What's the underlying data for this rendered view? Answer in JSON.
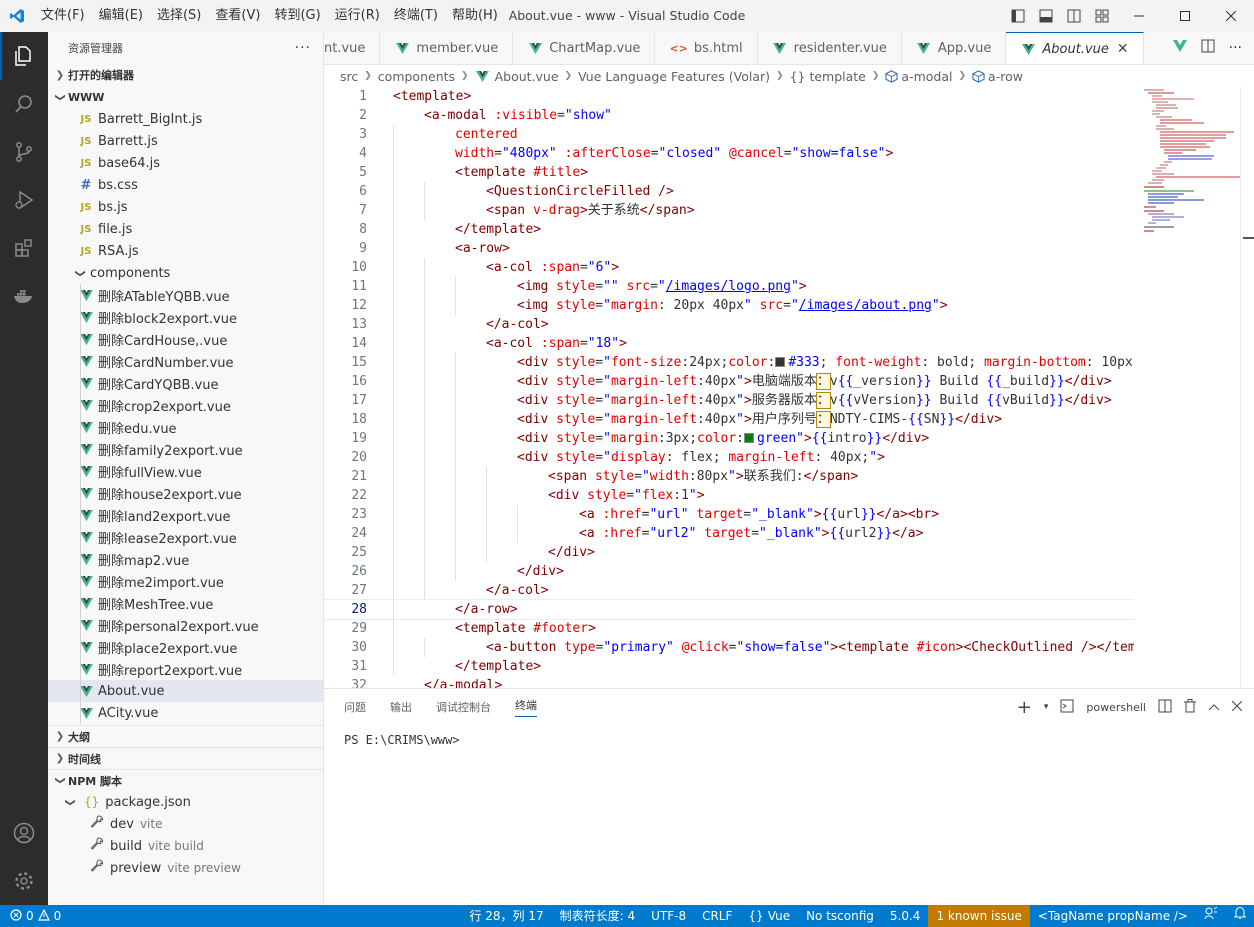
{
  "window": {
    "title": "About.vue - www - Visual Studio Code",
    "menu": [
      "文件(F)",
      "编辑(E)",
      "选择(S)",
      "查看(V)",
      "转到(G)",
      "运行(R)",
      "终端(T)",
      "帮助(H)"
    ]
  },
  "sidebar": {
    "title": "资源管理器",
    "open_editors": "打开的编辑器",
    "root": "WWW",
    "files": [
      {
        "name": "Barrett_BigInt.js",
        "type": "js"
      },
      {
        "name": "Barrett.js",
        "type": "js"
      },
      {
        "name": "base64.js",
        "type": "js"
      },
      {
        "name": "bs.css",
        "type": "css"
      },
      {
        "name": "bs.js",
        "type": "js"
      },
      {
        "name": "file.js",
        "type": "js"
      },
      {
        "name": "RSA.js",
        "type": "js"
      }
    ],
    "components_folder": "components",
    "components": [
      "删除ATableYQBB.vue",
      "删除block2export.vue",
      "删除CardHouse,.vue",
      "删除CardNumber.vue",
      "删除CardYQBB.vue",
      "删除crop2export.vue",
      "删除edu.vue",
      "删除family2export.vue",
      "删除fullView.vue",
      "删除house2export.vue",
      "删除land2export.vue",
      "删除lease2export.vue",
      "删除map2.vue",
      "删除me2import.vue",
      "删除MeshTree.vue",
      "删除personal2export.vue",
      "删除place2export.vue",
      "删除report2export.vue",
      "About.vue",
      "ACity.vue"
    ],
    "outline": "大纲",
    "timeline": "时间线",
    "npm": "NPM 脚本",
    "package": "package.json",
    "scripts": [
      {
        "name": "dev",
        "cmd": "vite"
      },
      {
        "name": "build",
        "cmd": "vite build"
      },
      {
        "name": "preview",
        "cmd": "vite preview"
      }
    ]
  },
  "tabs": [
    {
      "label": "nt.vue",
      "icon": "none"
    },
    {
      "label": "member.vue",
      "icon": "vue"
    },
    {
      "label": "ChartMap.vue",
      "icon": "vue"
    },
    {
      "label": "bs.html",
      "icon": "html"
    },
    {
      "label": "residenter.vue",
      "icon": "vue"
    },
    {
      "label": "App.vue",
      "icon": "vue"
    },
    {
      "label": "About.vue",
      "icon": "vue",
      "active": true
    }
  ],
  "breadcrumb": [
    "src",
    "components",
    "About.vue",
    "Vue Language Features (Volar)",
    "{} template",
    "a-modal",
    "a-row"
  ],
  "editor": {
    "current_line": 28,
    "lines": [
      {
        "n": "1",
        "indent": 0
      },
      {
        "n": "2",
        "indent": 1
      },
      {
        "n": "3",
        "indent": 2
      },
      {
        "n": "4",
        "indent": 2
      },
      {
        "n": "5",
        "indent": 2
      },
      {
        "n": "6",
        "indent": 3
      },
      {
        "n": "7",
        "indent": 3
      },
      {
        "n": "8",
        "indent": 2
      },
      {
        "n": "9",
        "indent": 2
      },
      {
        "n": "10",
        "indent": 3
      },
      {
        "n": "11",
        "indent": 4
      },
      {
        "n": "12",
        "indent": 4
      },
      {
        "n": "13",
        "indent": 3
      },
      {
        "n": "14",
        "indent": 3
      },
      {
        "n": "15",
        "indent": 4
      },
      {
        "n": "16",
        "indent": 4
      },
      {
        "n": "17",
        "indent": 4
      },
      {
        "n": "18",
        "indent": 4
      },
      {
        "n": "19",
        "indent": 4
      },
      {
        "n": "20",
        "indent": 4
      },
      {
        "n": "21",
        "indent": 5
      },
      {
        "n": "22",
        "indent": 5
      },
      {
        "n": "23",
        "indent": 6
      },
      {
        "n": "24",
        "indent": 6
      },
      {
        "n": "25",
        "indent": 5
      },
      {
        "n": "26",
        "indent": 4
      },
      {
        "n": "27",
        "indent": 3
      },
      {
        "n": "28",
        "indent": 2
      },
      {
        "n": "29",
        "indent": 2
      },
      {
        "n": "30",
        "indent": 3
      },
      {
        "n": "31",
        "indent": 2
      },
      {
        "n": "32",
        "indent": 1
      }
    ]
  },
  "panel": {
    "tabs": [
      "问题",
      "输出",
      "调试控制台",
      "终端"
    ],
    "active_tab": "终端",
    "shell": "powershell",
    "prompt": "PS E:\\CRIMS\\www>"
  },
  "statusbar": {
    "errors": "0",
    "warnings": "0",
    "position": "行 28，列 17",
    "tab_size": "制表符长度: 4",
    "encoding": "UTF-8",
    "eol": "CRLF",
    "language": "Vue",
    "tsconfig": "No tsconfig",
    "version": "5.0.4",
    "issue": "1 known issue",
    "tag_hint": "<TagName propName />"
  },
  "colors": {
    "accent": "#005fb8",
    "statusbar": "#007acc",
    "warning": "#c27a00",
    "vue_green": "#41b883"
  }
}
